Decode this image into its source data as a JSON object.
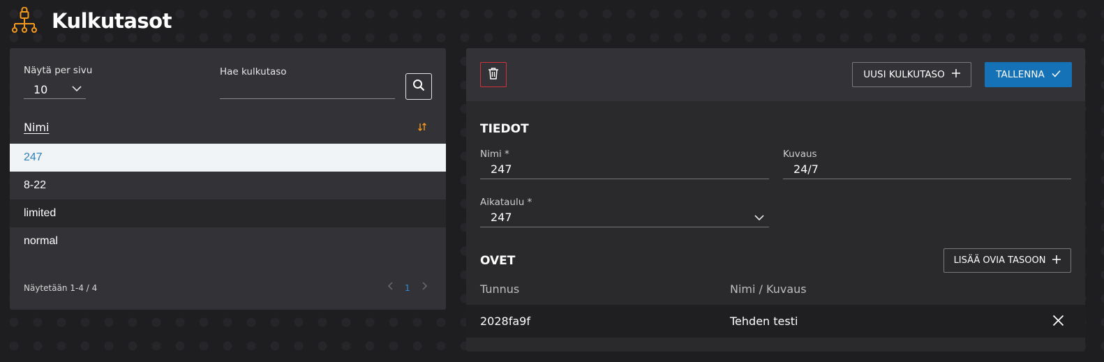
{
  "header": {
    "title": "Kulkutasot",
    "icon": "access-levels-icon",
    "accent": "#f59a1d"
  },
  "list_panel": {
    "per_page_label": "Näytä per sivu",
    "per_page_value": "10",
    "search_label": "Hae kulkutaso",
    "search_value": "",
    "column_header": "Nimi",
    "rows": [
      "247",
      "8-22",
      "limited",
      "normal"
    ],
    "selected_row": "247",
    "pager_text": "Näytetään  1-4 / 4",
    "current_page": "1"
  },
  "detail_panel": {
    "new_button": "UUSI KULKUTASO",
    "save_button": "TALLENNA",
    "info_title": "TIEDOT",
    "name_label": "Nimi *",
    "name_value": "247",
    "desc_label": "Kuvaus",
    "desc_value": "24/7",
    "schedule_label": "Aikataulu *",
    "schedule_value": "247",
    "doors_title": "OVET",
    "add_doors_button": "LISÄÄ OVIA TASOON",
    "doors_columns": [
      "Tunnus",
      "Nimi / Kuvaus"
    ],
    "doors": [
      {
        "id": "2028fa9f",
        "name": "Tehden testi"
      }
    ]
  },
  "colors": {
    "primary": "#1672b7",
    "danger": "#d2323c",
    "link": "#2d7fb8"
  }
}
